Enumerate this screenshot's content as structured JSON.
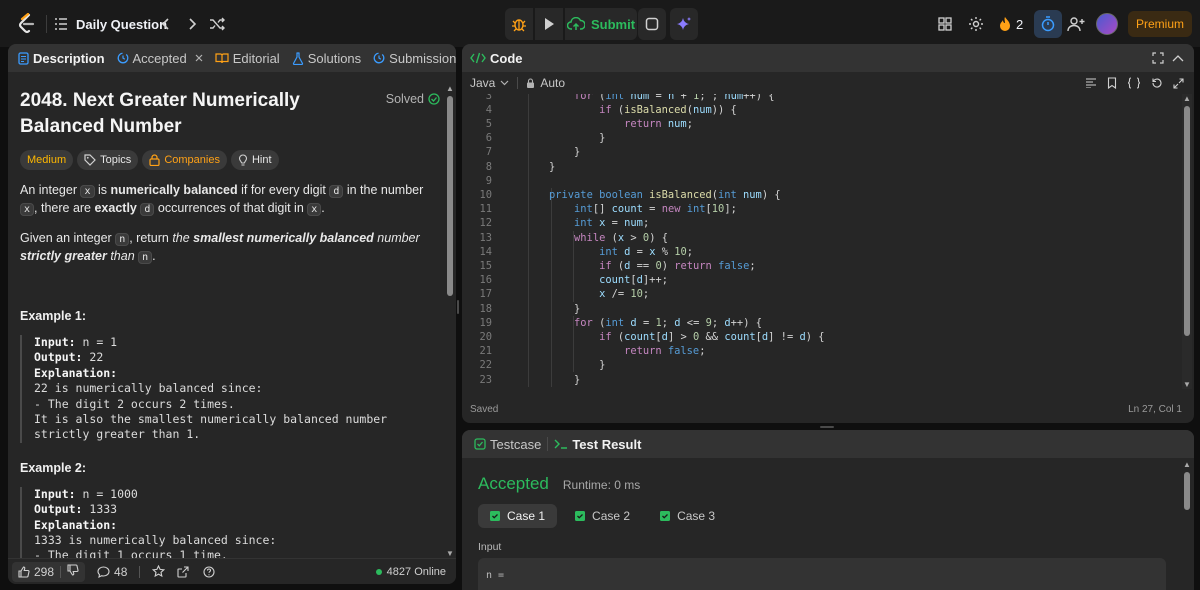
{
  "topbar": {
    "title": "Daily Question",
    "submit_label": "Submit",
    "streak_count": "2",
    "premium_label": "Premium",
    "icons": [
      "logo-icon",
      "list-icon",
      "chevron-left-icon",
      "chevron-right-icon",
      "shuffle-icon",
      "debug-icon",
      "play-icon",
      "cloud-upload-icon",
      "notes-icon",
      "sparkle-icon",
      "layout-icon",
      "gear-icon",
      "fire-icon",
      "timer-icon",
      "add-user-icon",
      "avatar"
    ],
    "colors": {
      "submit": "#2cbb5d",
      "streak": "#ffa116",
      "premium": "#ffa116",
      "timer": "#3b9cff"
    }
  },
  "left_panel": {
    "tabs": [
      {
        "label": "Description"
      },
      {
        "label": "Accepted"
      },
      {
        "label": "Editorial"
      },
      {
        "label": "Solutions"
      },
      {
        "label": "Submissions"
      }
    ],
    "problem": {
      "title": "2048. Next Greater Numerically Balanced Number",
      "status": "Solved",
      "tags": {
        "difficulty": "Medium",
        "topics": "Topics",
        "companies": "Companies",
        "hint": "Hint"
      },
      "p1": {
        "t1": "An integer ",
        "c1": "x",
        "t2": " is ",
        "b1": "numerically balanced",
        "t3": " if for every digit ",
        "c2": "d",
        "t4": " in the number ",
        "c3": "x",
        "t5": ", there are ",
        "b2": "exactly",
        "t6": " ",
        "c4": "d",
        "t7": " occurrences of that digit in ",
        "c5": "x",
        "t8": "."
      },
      "p2": {
        "t1": "Given an integer ",
        "c1": "n",
        "t2": ", return ",
        "i1": "the ",
        "bi1": "smallest numerically balanced",
        "i2": " number ",
        "bi2": "strictly greater",
        "i3": " than ",
        "c2": "n",
        "t3": "."
      },
      "examples": [
        {
          "title": "Example 1:",
          "input_label": "Input:",
          "input": " n = 1",
          "output_label": "Output:",
          "output": " 22",
          "explanation_label": "Explanation:",
          "lines": [
            "22 is numerically balanced since:",
            "- The digit 2 occurs 2 times.",
            "It is also the smallest numerically balanced number strictly greater than 1."
          ]
        },
        {
          "title": "Example 2:",
          "input_label": "Input:",
          "input": " n = 1000",
          "output_label": "Output:",
          "output": " 1333",
          "explanation_label": "Explanation:",
          "lines": [
            "1333 is numerically balanced since:",
            "- The digit 1 occurs 1 time."
          ]
        }
      ]
    },
    "footer": {
      "likes": "298",
      "comments": "48",
      "online": "4827 Online"
    }
  },
  "code_panel": {
    "title": "Code",
    "language": "Java",
    "auto_label": "Auto",
    "saved": "Saved",
    "cursor": "Ln 27, Col 1",
    "line_numbers": [
      "3",
      "4",
      "5",
      "6",
      "7",
      "8",
      "9",
      "10",
      "11",
      "12",
      "13",
      "14",
      "15",
      "16",
      "17",
      "18",
      "19",
      "20",
      "21",
      "22",
      "23"
    ],
    "code_lines": [
      "        for (int num = n + 1; ; num++) {",
      "            if (isBalanced(num)) {",
      "                return num;",
      "            }",
      "        }",
      "    }",
      "",
      "    private boolean isBalanced(int num) {",
      "        int[] count = new int[10];",
      "        int x = num;",
      "        while (x > 0) {",
      "            int d = x % 10;",
      "            if (d == 0) return false;",
      "            count[d]++;",
      "            x /= 10;",
      "        }",
      "        for (int d = 1; d <= 9; d++) {",
      "            if (count[d] > 0 && count[d] != d) {",
      "                return false;",
      "            }",
      "        }"
    ]
  },
  "result_panel": {
    "tabs": [
      {
        "label": "Testcase"
      },
      {
        "label": "Test Result"
      }
    ],
    "status": "Accepted",
    "runtime": "Runtime: 0 ms",
    "cases": [
      "Case 1",
      "Case 2",
      "Case 3"
    ],
    "input_label": "Input",
    "input_value": "n ="
  }
}
